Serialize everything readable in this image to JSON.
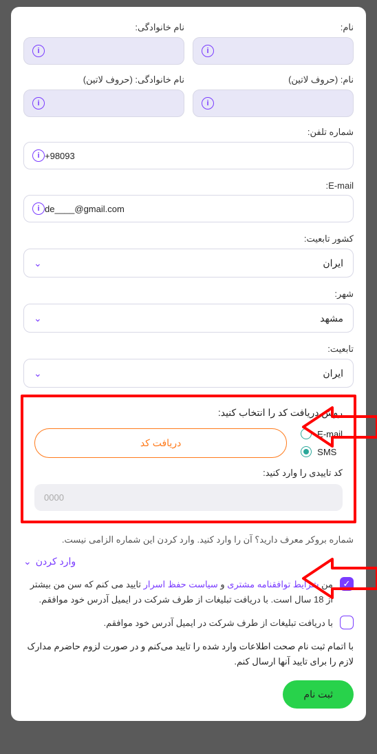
{
  "fields": {
    "first_name": {
      "label": "نام:",
      "value": ""
    },
    "last_name": {
      "label": "نام خانوادگی:",
      "value": ""
    },
    "first_name_latin": {
      "label": "نام: (حروف لاتین)",
      "value": ""
    },
    "last_name_latin": {
      "label": "نام خانوادگی: (حروف لاتین)",
      "value": ""
    },
    "phone": {
      "label": "شماره تلفن:",
      "value": "+98093"
    },
    "email": {
      "label": "E-mail:",
      "value": "de____@gmail.com"
    },
    "country": {
      "label": "کشور تابعیت:",
      "value": "ایران"
    },
    "city": {
      "label": "شهر:",
      "value": "مشهد"
    },
    "nationality": {
      "label": "تابعیت:",
      "value": "ایران"
    }
  },
  "code": {
    "title": "روش دریافت کد را انتخاب کنید:",
    "options": {
      "email": "E-mail",
      "sms": "SMS"
    },
    "selected": "sms",
    "get_btn": "دریافت کد",
    "confirm_label": "کد تاییدی را وارد کنید:",
    "placeholder": "0000"
  },
  "referral": {
    "note": "شماره بروکر معرف دارید؟ آن را وارد کنید. وارد کردن این شماره الزامی نیست.",
    "toggle": "وارد کردن"
  },
  "agreements": {
    "terms_prefix": "من ",
    "terms_link1": "شرایط توافقنامه مشتری",
    "terms_sep": " و ",
    "terms_link2": "سیاست حفظ اسرار",
    "terms_rest": " تایید می کنم که سن من بیشتر از 18 سال است. با دریافت تبلیغات از طرف شرکت در ایمیل آدرس خود موافقم.",
    "ads": "با دریافت تبلیغات از طرف شرکت در ایمیل آدرس خود موافقم."
  },
  "final_note": "با اتمام ثبت نام صحت اطلاعات وارد شده را تایید می‌کنم و در صورت لزوم حاضرم مدارک لازم را برای تایید آنها ارسال کنم.",
  "submit": "ثبت نام"
}
